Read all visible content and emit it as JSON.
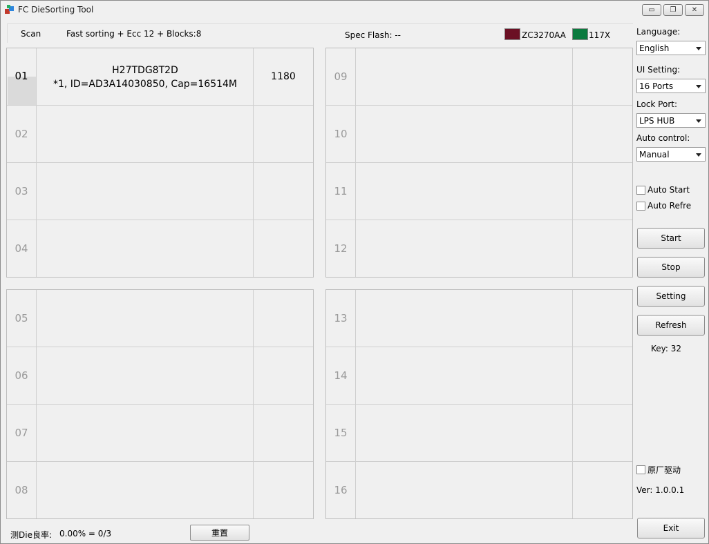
{
  "window": {
    "title": "FC DieSorting Tool",
    "minimize_glyph": "▭",
    "restore_glyph": "❐",
    "close_glyph": "✕"
  },
  "topbar": {
    "scan": "Scan",
    "mode": "Fast sorting + Ecc 12 + Blocks:8",
    "spec_flash": "Spec Flash:  --",
    "chip1": {
      "label": "ZC3270AA",
      "color": "#6b1024"
    },
    "chip2": {
      "label": "117X",
      "color": "#0a7a3e"
    }
  },
  "slots": [
    {
      "num": "01",
      "line1": "H27TDG8T2D",
      "line2": "*1, ID=AD3A14030850, Cap=16514M",
      "value": "1180",
      "active": true
    },
    {
      "num": "02",
      "line1": "",
      "line2": "",
      "value": ""
    },
    {
      "num": "03",
      "line1": "",
      "line2": "",
      "value": ""
    },
    {
      "num": "04",
      "line1": "",
      "line2": "",
      "value": ""
    },
    {
      "num": "05",
      "line1": "",
      "line2": "",
      "value": ""
    },
    {
      "num": "06",
      "line1": "",
      "line2": "",
      "value": ""
    },
    {
      "num": "07",
      "line1": "",
      "line2": "",
      "value": ""
    },
    {
      "num": "08",
      "line1": "",
      "line2": "",
      "value": ""
    },
    {
      "num": "09",
      "line1": "",
      "line2": "",
      "value": ""
    },
    {
      "num": "10",
      "line1": "",
      "line2": "",
      "value": ""
    },
    {
      "num": "11",
      "line1": "",
      "line2": "",
      "value": ""
    },
    {
      "num": "12",
      "line1": "",
      "line2": "",
      "value": ""
    },
    {
      "num": "13",
      "line1": "",
      "line2": "",
      "value": ""
    },
    {
      "num": "14",
      "line1": "",
      "line2": "",
      "value": ""
    },
    {
      "num": "15",
      "line1": "",
      "line2": "",
      "value": ""
    },
    {
      "num": "16",
      "line1": "",
      "line2": "",
      "value": ""
    }
  ],
  "side": {
    "language_label": "Language:",
    "language_value": "English",
    "ui_label": "UI Setting:",
    "ui_value": "16 Ports",
    "lock_label": "Lock Port:",
    "lock_value": "LPS HUB",
    "auto_label": "Auto control:",
    "auto_value": "Manual",
    "auto_start": "Auto Start",
    "auto_refresh": "Auto Refre",
    "start": "Start",
    "stop": "Stop",
    "setting": "Setting",
    "refresh": "Refresh",
    "key": "Key: 32",
    "original_driver": "原厂驱动",
    "version": "Ver: 1.0.0.1",
    "exit": "Exit"
  },
  "footer": {
    "rate_label": "测Die良率:",
    "rate_value": "0.00% = 0/3",
    "reset": "重置"
  }
}
